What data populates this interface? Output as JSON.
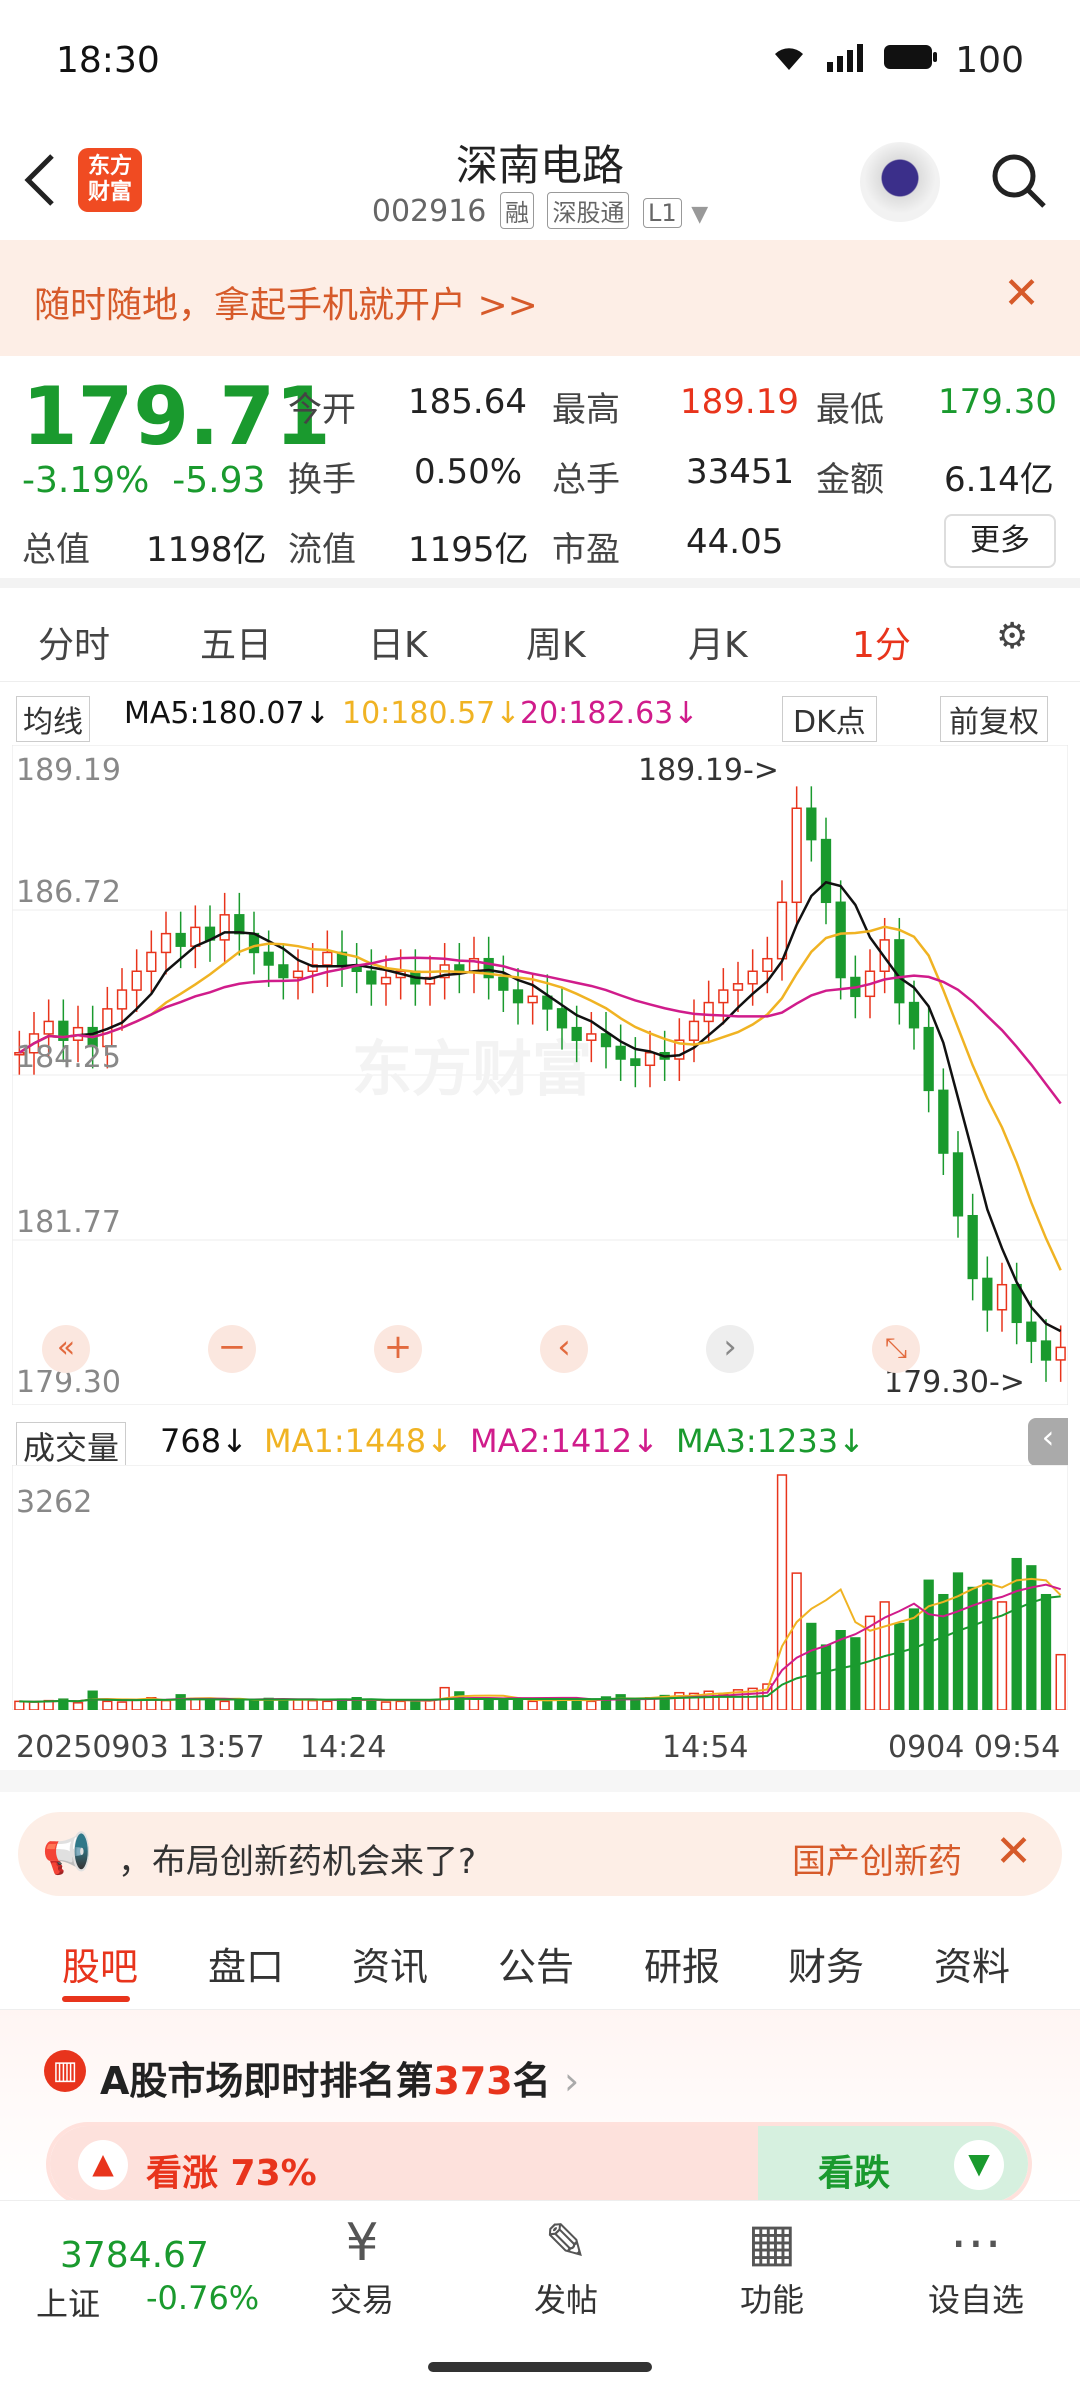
{
  "status": {
    "time": "18:30",
    "battery": "100"
  },
  "header": {
    "title": "深南电路",
    "code": "002916",
    "tags": [
      "融",
      "深股通",
      "L1"
    ],
    "logo": "东方\n财富"
  },
  "banner": {
    "text": "随时随地，拿起手机就开户 >>"
  },
  "quote": {
    "price": "179.71",
    "chg_pct": "-3.19%",
    "chg": "-5.93",
    "open_label": "今开",
    "open": "185.64",
    "high_label": "最高",
    "high": "189.19",
    "low_label": "最低",
    "low": "179.30",
    "turnover_label": "换手",
    "turnover": "0.50%",
    "vol_label": "总手",
    "vol": "33451",
    "amt_label": "金额",
    "amt": "6.14亿",
    "mktcap_label": "总值",
    "mktcap": "1198亿",
    "float_label": "流值",
    "float": "1195亿",
    "pe_label": "市盈",
    "pe": "44.05",
    "more": "更多"
  },
  "period_tabs": [
    "分时",
    "五日",
    "日K",
    "周K",
    "月K",
    "1分",
    "⚙"
  ],
  "ma_legend": {
    "mode": "均线",
    "ma5": "MA5:180.07↓",
    "ma10": "10:180.57↓",
    "ma20": "20:182.63↓",
    "dk": "DK点",
    "adj": "前复权"
  },
  "chart_labels": {
    "y1": "189.19",
    "y2": "186.72",
    "y3": "184.25",
    "y4": "181.77",
    "y5": "179.30",
    "max_mark": "189.19->",
    "min_mark": "179.30->",
    "watermark": "东方财富"
  },
  "vol_legend": {
    "mode": "成交量",
    "vol": "768↓",
    "ma1": "MA1:1448↓",
    "ma2": "MA2:1412↓",
    "ma3": "MA3:1233↓",
    "max": "3262"
  },
  "time_axis": [
    "20250903 13:57",
    "14:24",
    "14:54",
    "0904 09:54"
  ],
  "ad": {
    "text": "，布局创新药机会来了?",
    "tag": "国产创新药"
  },
  "content_tabs": [
    "股吧",
    "盘口",
    "资讯",
    "公告",
    "研报",
    "财务",
    "资料"
  ],
  "rank": {
    "text_a": "A股市场即时排名第",
    "rank": "373",
    "text_b": "名"
  },
  "vote": {
    "up": "看涨 73%",
    "down": "看跌"
  },
  "bottom": {
    "index_value": "3784.67",
    "index_name": "上证",
    "index_chg": "-0.76%",
    "items": [
      "交易",
      "发帖",
      "功能",
      "设自选"
    ]
  },
  "colors": {
    "up": "#e8341c",
    "down": "#1a9a2e",
    "ma5": "#111111",
    "ma10": "#f0b323",
    "ma20": "#d01c8b"
  },
  "chart_data": {
    "type": "candlestick",
    "ylim": [
      179.3,
      189.19
    ],
    "close": [
      184.6,
      184.9,
      185.1,
      184.8,
      185.0,
      184.7,
      185.3,
      185.6,
      185.9,
      186.2,
      186.5,
      186.3,
      186.6,
      186.4,
      186.8,
      186.5,
      186.2,
      186.0,
      185.8,
      185.9,
      186.0,
      186.2,
      186.0,
      185.9,
      185.7,
      185.8,
      185.9,
      185.7,
      185.8,
      186.0,
      185.9,
      186.1,
      185.8,
      185.6,
      185.4,
      185.5,
      185.3,
      185.0,
      184.8,
      184.9,
      184.7,
      184.5,
      184.4,
      184.6,
      184.5,
      184.8,
      185.1,
      185.4,
      185.6,
      185.7,
      185.9,
      186.1,
      187.0,
      188.5,
      188.0,
      187.0,
      185.8,
      185.5,
      185.9,
      186.4,
      185.4,
      185.0,
      184.0,
      183.0,
      182.0,
      181.0,
      180.5,
      180.9,
      180.3,
      180.0,
      179.7,
      179.9
    ],
    "volume": [
      120,
      110,
      130,
      150,
      100,
      260,
      120,
      110,
      140,
      170,
      130,
      210,
      160,
      150,
      120,
      140,
      130,
      160,
      150,
      140,
      130,
      120,
      150,
      170,
      130,
      110,
      120,
      130,
      140,
      310,
      250,
      160,
      140,
      130,
      150,
      120,
      130,
      160,
      140,
      120,
      180,
      210,
      150,
      170,
      200,
      240,
      230,
      260,
      220,
      280,
      300,
      360,
      3262,
      1900,
      1200,
      900,
      1100,
      1000,
      1300,
      1500,
      1200,
      1400,
      1800,
      1600,
      1900,
      1700,
      1800,
      1500,
      2100,
      2000,
      1600,
      768
    ]
  }
}
